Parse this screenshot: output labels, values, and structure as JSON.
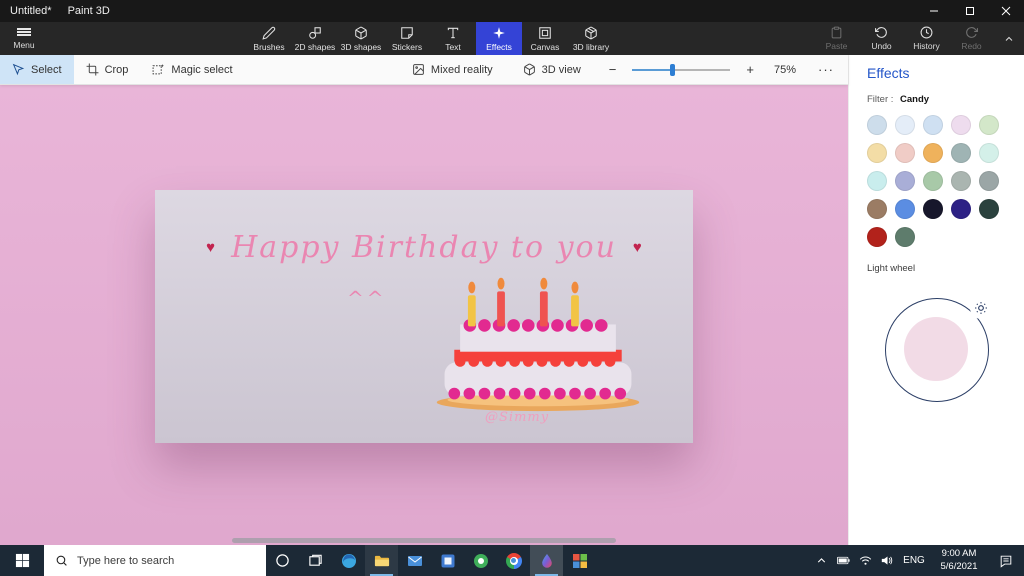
{
  "colors": {
    "accent_blue": "#3443d6",
    "panel_title_blue": "#2456c9",
    "select_highlight": "#cfe4f7",
    "canvas_pink": "#e5b0d5",
    "taskbar_navy": "#1c2936",
    "greeting_pink": "#ea86b1",
    "heart_red": "#c2244f"
  },
  "window": {
    "title": "Untitled*",
    "app_name": "Paint 3D"
  },
  "toolbar": {
    "menu_label": "Menu",
    "tools": [
      {
        "label": "Brushes"
      },
      {
        "label": "2D shapes"
      },
      {
        "label": "3D shapes"
      },
      {
        "label": "Stickers"
      },
      {
        "label": "Text"
      },
      {
        "label": "Effects"
      },
      {
        "label": "Canvas"
      },
      {
        "label": "3D library"
      }
    ],
    "active_tool": "Effects",
    "paste_label": "Paste",
    "undo_label": "Undo",
    "history_label": "History",
    "redo_label": "Redo"
  },
  "subtoolbar": {
    "select_label": "Select",
    "crop_label": "Crop",
    "magic_select_label": "Magic select",
    "mixed_reality_label": "Mixed reality",
    "view_3d_label": "3D view",
    "zoom_out": "−",
    "zoom_in": "+",
    "zoom_level": "75%",
    "more": "···"
  },
  "effects_panel": {
    "title": "Effects",
    "filter_label": "Filter :",
    "filter_value": "Candy",
    "light_wheel_label": "Light wheel",
    "swatches": [
      "#cdddeb",
      "#e4edf8",
      "#cfe0f2",
      "#eedcee",
      "#d3e7c9",
      "#f3dda6",
      "#f0ccc6",
      "#efb25c",
      "#9fb4b4",
      "#d4f0e9",
      "#c9eded",
      "#a9aed7",
      "#a8c9a8",
      "#aab5b0",
      "#9ba6a6",
      "#9b7c64",
      "#5b8de2",
      "#17172b",
      "#2d2185",
      "#2b423e",
      "#b2221b",
      "#5e7c6c"
    ]
  },
  "canvas": {
    "heart": "♥",
    "greeting_text": "Happy Birthday to you",
    "emoticon": "^^",
    "watermark": "@Simmy"
  },
  "taskbar": {
    "search_placeholder": "Type here to search",
    "app_icons": [
      "edge",
      "file-explorer",
      "mail",
      "blue-app",
      "green-app",
      "chrome",
      "paint-3d",
      "colorful-app"
    ],
    "open_apps": [
      "file-explorer",
      "paint-3d"
    ],
    "language": "ENG",
    "time": "9:00 AM",
    "date": "5/6/2021"
  }
}
